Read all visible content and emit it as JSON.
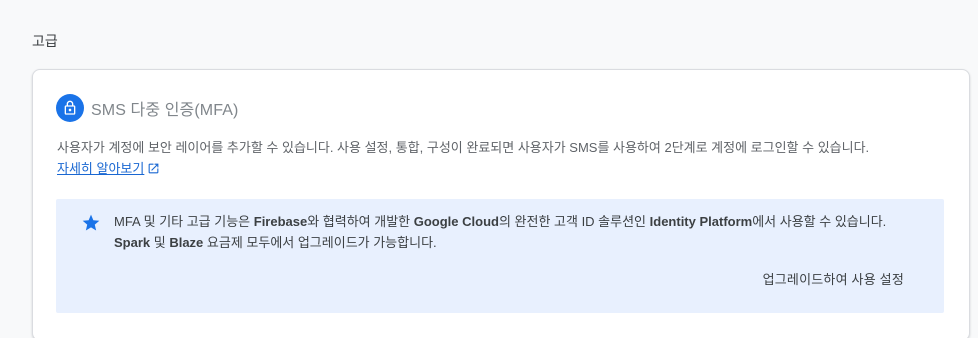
{
  "section": {
    "title": "고급"
  },
  "card": {
    "title": "SMS 다중 인증(MFA)",
    "lock_icon": "lock-icon",
    "description": "사용자가 계정에 보안 레이어를 추가할 수 있습니다. 사용 설정, 통합, 구성이 완료되면 사용자가 SMS를 사용하여 2단계로 계정에 로그인할 수 있습니다.",
    "learn_more": "자세히 알아보기",
    "external_icon": "open-in-new-icon",
    "accent_color": "#1a73e8"
  },
  "info_box": {
    "star_icon": "star-icon",
    "text_1": "MFA 및 기타 고급 기능은 ",
    "firebase": "Firebase",
    "text_2": "와 협력하여 개발한 ",
    "google_cloud": "Google Cloud",
    "text_3": "의 완전한 고객 ID 솔루션인 ",
    "identity_platform": "Identity Platform",
    "text_4": "에서 사용할 수 있습니다. ",
    "spark": "Spark",
    "text_5": " 및 ",
    "blaze": "Blaze",
    "text_6": " 요금제 모두에서 업그레이드가 가능합니다.",
    "upgrade_button": "업그레이드하여 사용 설정",
    "background_color": "#e8f0fe"
  }
}
